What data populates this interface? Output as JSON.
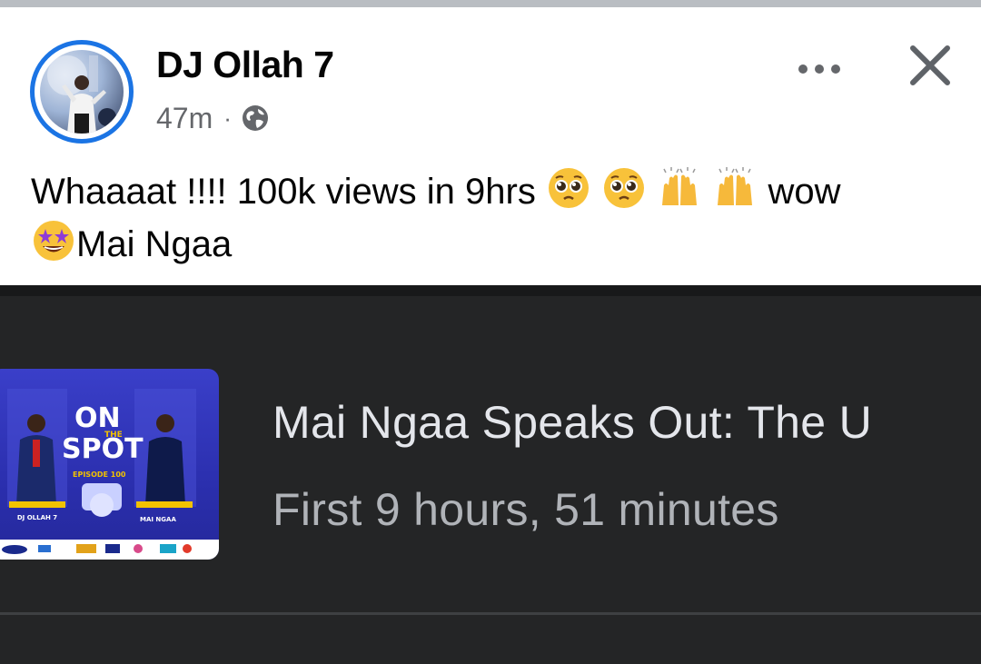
{
  "post": {
    "author": "DJ Ollah 7",
    "timestamp": "47m",
    "separator": "·",
    "audience_icon": "globe-icon",
    "line1_text": "Whaaaat !!!! 100k views in 9hrs",
    "line1_trailing": "wow",
    "line2_text": "Mai Ngaa",
    "emojis": [
      "pleading-face",
      "pleading-face",
      "raising-hands",
      "raising-hands",
      "star-struck"
    ]
  },
  "embed": {
    "title": "Mai Ngaa Speaks Out: The U",
    "subtitle": "First 9 hours, 51 minutes",
    "thumbnail": {
      "show": "ON THE SPOT",
      "on": "ON",
      "the": "THE",
      "spot": "SPOT",
      "episode": "EPISODE 100",
      "host": "DJ OLLAH 7",
      "guest": "MAI NGAA"
    }
  },
  "colors": {
    "avatar_ring": "#1b74e4",
    "embed_bg": "#242526",
    "embed_title": "#e4e6eb",
    "embed_sub": "#b0b3b8",
    "thumb_bg": "#2b2fae",
    "meta": "#65676b"
  }
}
